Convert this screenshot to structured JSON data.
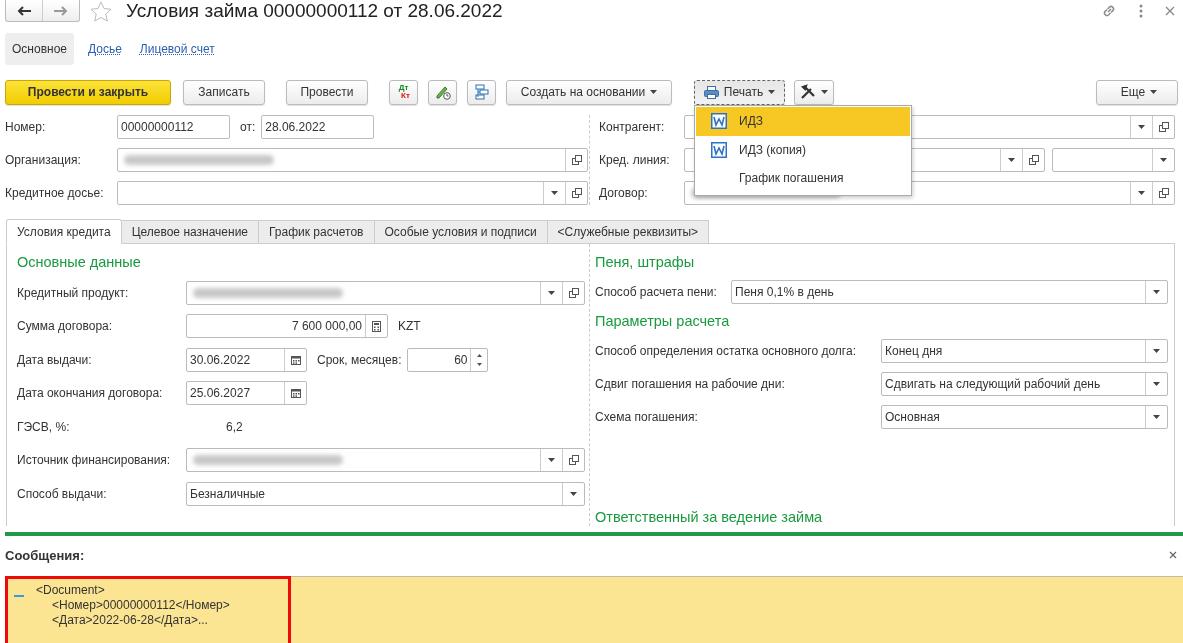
{
  "window": {
    "title": "Условия займа 00000000112 от 28.06.2022"
  },
  "sections": [
    {
      "label": "Основное",
      "selected": true
    },
    {
      "label": "Досье",
      "selected": false
    },
    {
      "label": "Лицевой счет",
      "selected": false
    }
  ],
  "toolbar": [
    {
      "kind": "primary",
      "label": "Провести и закрыть"
    },
    {
      "kind": "plain",
      "label": "Записать"
    },
    {
      "kind": "plain",
      "label": "Провести"
    },
    {
      "kind": "dtkt",
      "labels": [
        "Дт",
        "Кт"
      ]
    },
    {
      "kind": "history"
    },
    {
      "kind": "hierarchy"
    },
    {
      "kind": "dropdown",
      "label": "Создать на основании"
    },
    {
      "kind": "print",
      "label": "Печать",
      "open": true
    },
    {
      "kind": "service"
    },
    {
      "kind": "more",
      "label": "Еще"
    }
  ],
  "print_menu": [
    {
      "label": "ИДЗ",
      "kind": "word",
      "selected": true
    },
    {
      "label": "ИДЗ (копия)",
      "kind": "word",
      "selected": false
    },
    {
      "label": "График погашения",
      "kind": "plain",
      "selected": false
    }
  ],
  "header_left": [
    {
      "label": "Номер:",
      "kind": "text",
      "value": "00000000112",
      "extra": {
        "label": "от:",
        "kind": "text",
        "value": "28.06.2022"
      }
    },
    {
      "label": "Организация:",
      "kind": "ref",
      "redacted": true
    },
    {
      "label": "Кредитное досье:",
      "kind": "select_ref"
    }
  ],
  "header_right": [
    {
      "label": "Контрагент:",
      "kind": "select_ref"
    },
    {
      "label": "Кред. линия:",
      "kind": "select_ref",
      "extra": {
        "kind": "select"
      }
    },
    {
      "label": "Договор:",
      "kind": "select_ref",
      "redacted": true
    }
  ],
  "tabs": [
    {
      "label": "Условия кредита",
      "selected": true
    },
    {
      "label": "Целевое назначение",
      "selected": false
    },
    {
      "label": "График расчетов",
      "selected": false
    },
    {
      "label": "Особые условия и подписи",
      "selected": false
    },
    {
      "label": "<Служебные реквизиты>",
      "selected": false
    }
  ],
  "main_data": {
    "heading": "Основные данные",
    "fields": [
      {
        "label": "Кредитный продукт:",
        "kind": "select_ref",
        "redacted": true
      },
      {
        "label": "Сумма договора:",
        "kind": "number",
        "value": "7 600 000,00",
        "unit": "KZT"
      },
      {
        "label": "Дата выдачи:",
        "kind": "date",
        "value": "30.06.2022",
        "extra": {
          "label": "Срок, месяцев:",
          "kind": "spin",
          "value": "60"
        }
      },
      {
        "label": "Дата окончания договора:",
        "kind": "date",
        "value": "25.06.2027"
      },
      {
        "label": "ГЭСВ, %:",
        "kind": "static",
        "value": "6,2"
      },
      {
        "label": "Источник финансирования:",
        "kind": "select_ref",
        "redacted": true
      },
      {
        "label": "Способ выдачи:",
        "kind": "select",
        "value": "Безналичные"
      }
    ]
  },
  "penalties": {
    "heading": "Пеня, штрафы",
    "fields": [
      {
        "label": "Способ расчета пени:",
        "kind": "select",
        "value": "Пеня 0,1% в день"
      }
    ]
  },
  "calc_params": {
    "heading": "Параметры расчета",
    "fields": [
      {
        "label": "Способ определения остатка основного долга:",
        "kind": "select",
        "value": "Конец дня"
      },
      {
        "label": "Сдвиг погашения на рабочие дни:",
        "kind": "select",
        "value": "Сдвигать на следующий рабочий день"
      },
      {
        "label": "Схема погашения:",
        "kind": "select",
        "value": "Основная"
      }
    ]
  },
  "responsible": {
    "heading": "Ответственный за ведение займа"
  },
  "messages": {
    "title": "Сообщения:",
    "expanded": true,
    "lines": [
      "<Document>",
      "<Номер>00000000112</Номер>",
      "<Дата>2022-06-28</Дата>..."
    ],
    "highlighted": true
  }
}
